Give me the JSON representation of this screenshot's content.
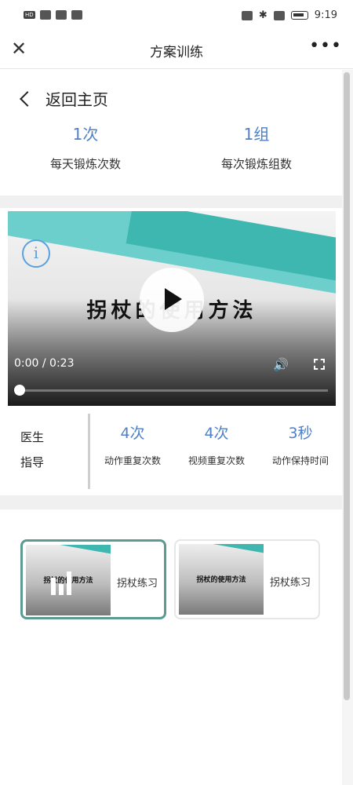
{
  "status_bar": {
    "badge": "HD",
    "time": "9:19"
  },
  "header": {
    "title": "方案训练",
    "more": "•••"
  },
  "back": {
    "label": "返回主页"
  },
  "plan_stats": [
    {
      "value": "1次",
      "label": "每天锻炼次数"
    },
    {
      "value": "1组",
      "label": "每次锻炼组数"
    }
  ],
  "video": {
    "title": "拐杖的使用方法",
    "time": "0:00 / 0:23",
    "progress": 0
  },
  "doctor": {
    "label_line1": "医生",
    "label_line2": "指导",
    "stats": [
      {
        "value": "4次",
        "label": "动作重复次数"
      },
      {
        "value": "4次",
        "label": "视频重复次数"
      },
      {
        "value": "3秒",
        "label": "动作保持时间"
      }
    ]
  },
  "exercises": [
    {
      "thumb_title": "拐杖的使用方法",
      "name": "拐杖练习",
      "active": true
    },
    {
      "thumb_title": "拐杖的使用方法",
      "name": "拐杖练习",
      "active": false
    }
  ],
  "colors": {
    "accent": "#4f80c8",
    "teal": "#3fb7b1",
    "active_border": "#5b9b91"
  }
}
